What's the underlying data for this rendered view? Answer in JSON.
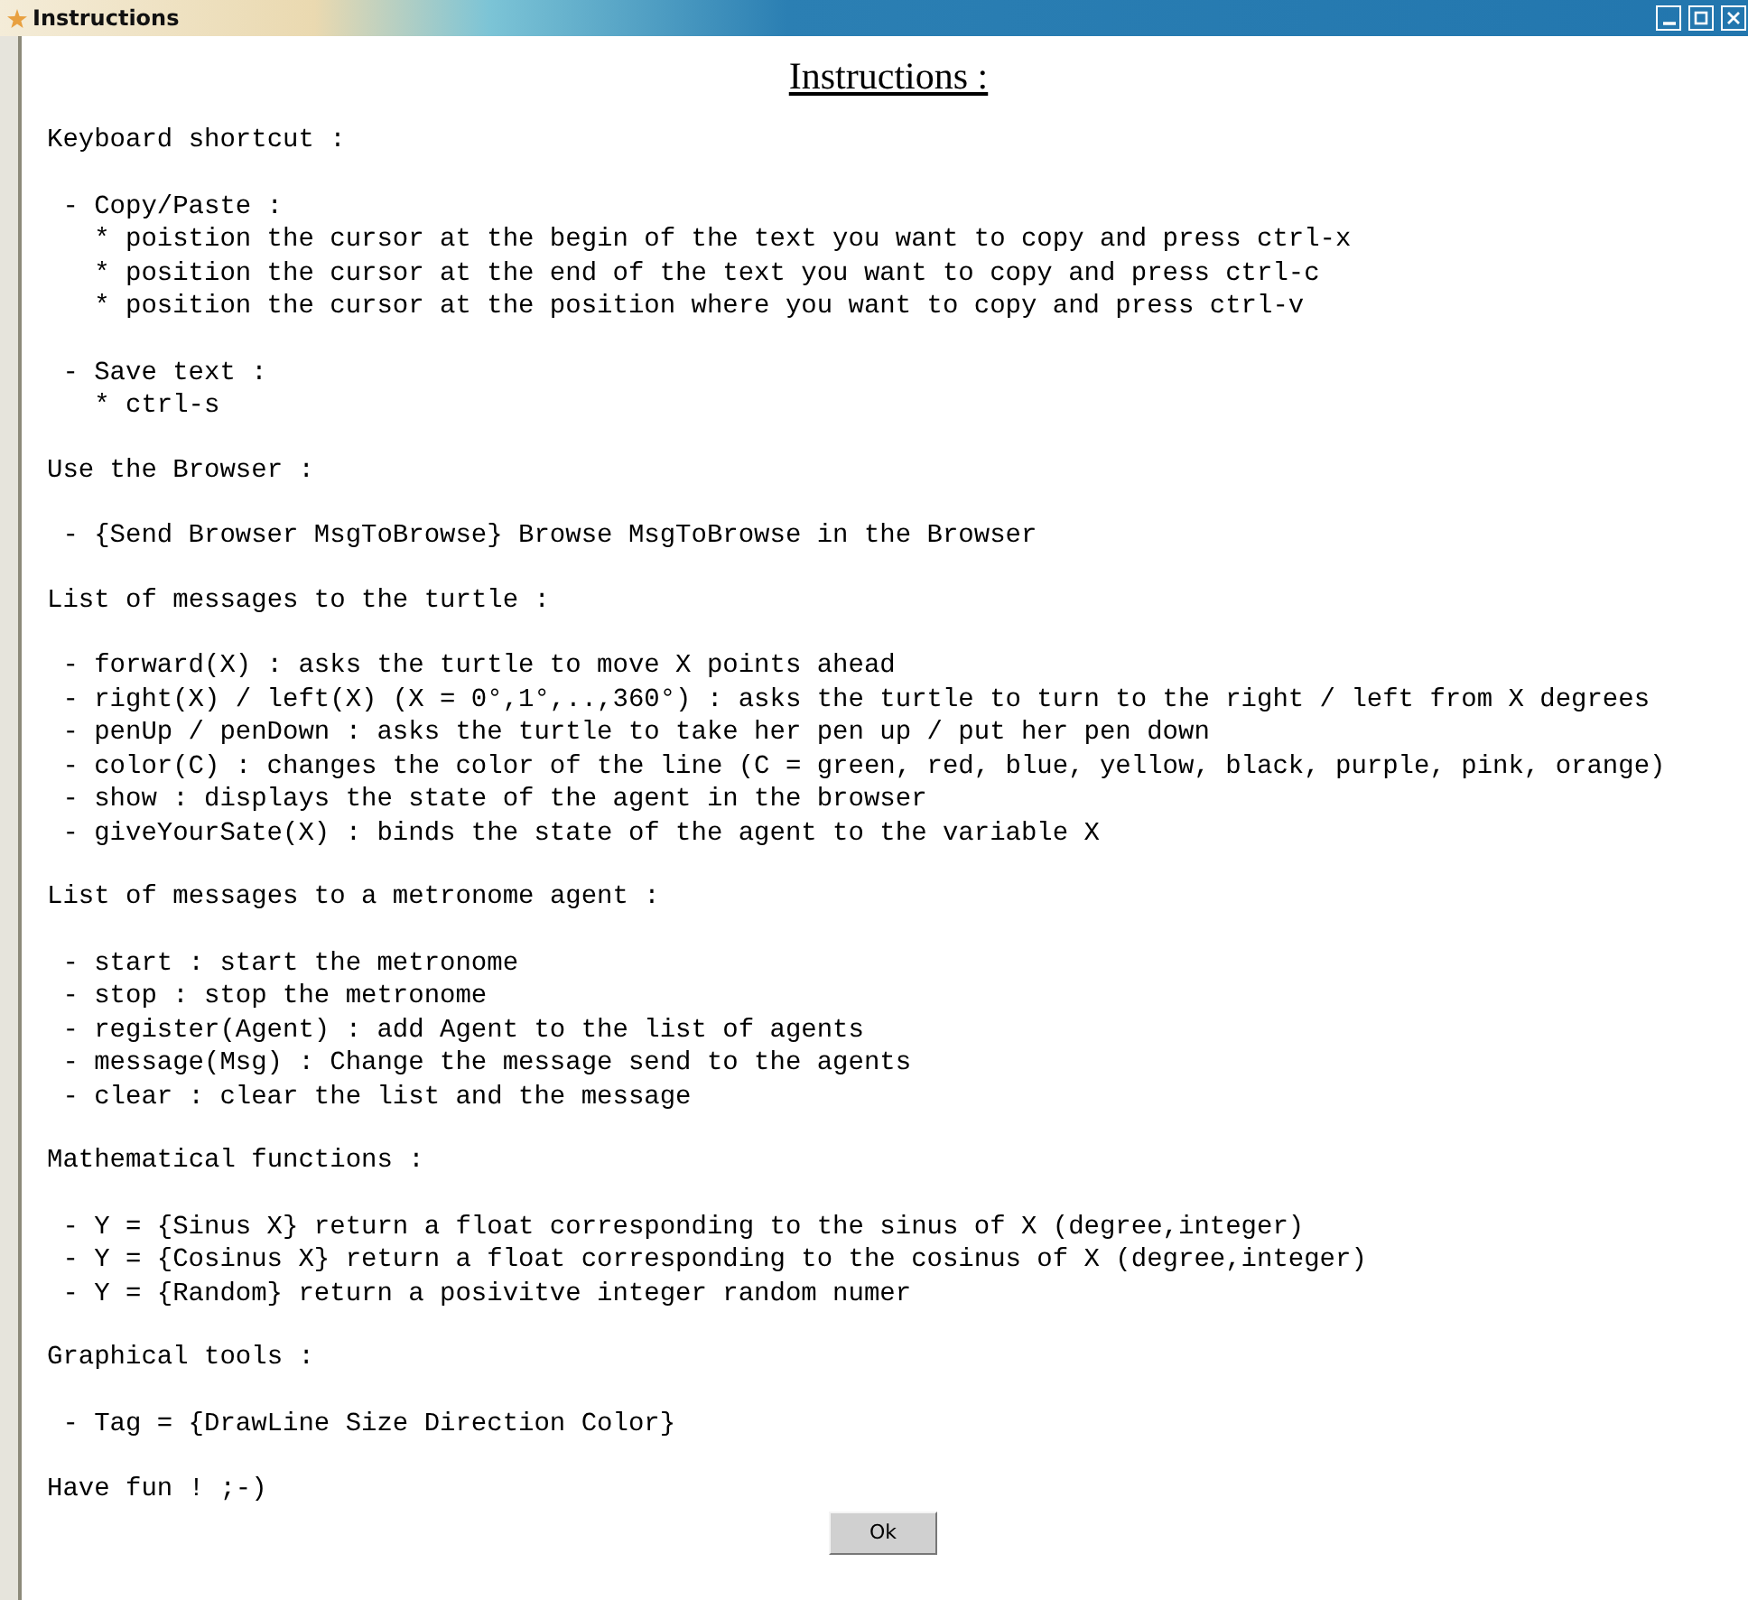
{
  "window": {
    "title": "Instructions"
  },
  "heading": "Instructions :",
  "sections": [
    {
      "heading": "Keyboard shortcut :",
      "blocks": [
        [
          {
            "kind": "item",
            "text": "- Copy/Paste :"
          },
          {
            "kind": "subitem",
            "text": "* poistion the cursor at the begin of the text you want to copy and press ctrl-x"
          },
          {
            "kind": "subitem",
            "text": "* position the cursor at the end of the text you want to copy and press ctrl-c"
          },
          {
            "kind": "subitem",
            "text": "* position the cursor at the position where you want to copy and press ctrl-v"
          }
        ],
        [
          {
            "kind": "item",
            "text": "- Save text :"
          },
          {
            "kind": "subitem",
            "text": "* ctrl-s"
          }
        ]
      ]
    },
    {
      "heading": "Use the Browser :",
      "blocks": [
        [
          {
            "kind": "item",
            "text": "- {Send Browser MsgToBrowse} Browse MsgToBrowse in the Browser"
          }
        ]
      ]
    },
    {
      "heading": "List of messages to the turtle :",
      "blocks": [
        [
          {
            "kind": "item",
            "text": "- forward(X) : asks the turtle to move X points ahead"
          },
          {
            "kind": "item",
            "text": "- right(X) / left(X) (X = 0°,1°,..,360°) : asks the turtle to turn to the right / left from X degrees"
          },
          {
            "kind": "item",
            "text": "- penUp / penDown : asks the turtle to take her pen up / put her pen down"
          },
          {
            "kind": "item",
            "text": "- color(C) : changes the color of the line (C = green, red, blue, yellow, black, purple, pink, orange)"
          },
          {
            "kind": "item",
            "text": "- show : displays the state of the agent in the browser"
          },
          {
            "kind": "item",
            "text": "- giveYourSate(X) : binds the state of the agent to the variable X"
          }
        ]
      ]
    },
    {
      "heading": "List of messages to a metronome agent :",
      "blocks": [
        [
          {
            "kind": "item",
            "text": "- start : start the metronome"
          },
          {
            "kind": "item",
            "text": "- stop : stop the metronome"
          },
          {
            "kind": "item",
            "text": "- register(Agent) : add Agent to the list of agents"
          },
          {
            "kind": "item",
            "text": "- message(Msg) : Change the message send to the agents"
          },
          {
            "kind": "item",
            "text": "- clear : clear the list and the message"
          }
        ]
      ]
    },
    {
      "heading": "Mathematical functions :",
      "blocks": [
        [
          {
            "kind": "item",
            "text": "- Y = {Sinus X} return a float corresponding to the sinus of X (degree,integer)"
          },
          {
            "kind": "item",
            "text": "- Y = {Cosinus X} return a float corresponding to the cosinus of X (degree,integer)"
          },
          {
            "kind": "item",
            "text": "- Y = {Random} return a posivitve integer random numer"
          }
        ]
      ]
    },
    {
      "heading": "Graphical tools :",
      "blocks": [
        [
          {
            "kind": "item",
            "text": "- Tag = {DrawLine Size Direction Color}"
          }
        ]
      ]
    }
  ],
  "closing": "Have fun ! ;-)",
  "ok_button": "Ok"
}
